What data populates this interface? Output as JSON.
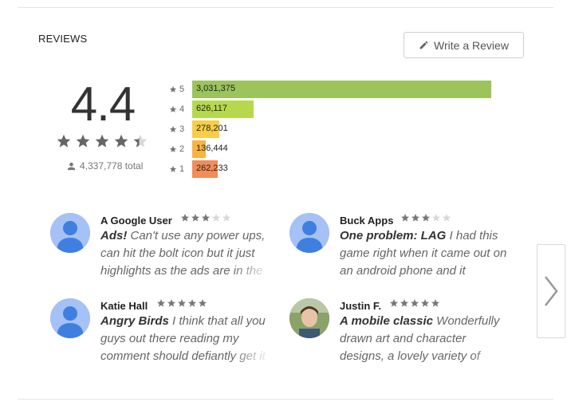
{
  "section": {
    "title": "REVIEWS",
    "write_review_label": "Write a Review"
  },
  "summary": {
    "score": "4.4",
    "stars_fraction": 0.88,
    "total": "4,337,778 total"
  },
  "histogram": [
    {
      "star": "5",
      "count": "3,031,375",
      "fraction": 1.0,
      "color": "#9dc35b"
    },
    {
      "star": "4",
      "count": "626,117",
      "fraction": 0.2065,
      "color": "#b6d84d"
    },
    {
      "star": "3",
      "count": "278,201",
      "fraction": 0.0918,
      "color": "#f7ce46"
    },
    {
      "star": "2",
      "count": "136,444",
      "fraction": 0.045,
      "color": "#f9b342"
    },
    {
      "star": "1",
      "count": "262,233",
      "fraction": 0.0865,
      "color": "#f28c58"
    }
  ],
  "reviews": [
    {
      "name": "A Google User",
      "rating": 3,
      "title": "Ads!",
      "body": " Can't use any power ups, can hit the bolt icon but it just highlights as the ads are in the",
      "avatar": "default-avatar"
    },
    {
      "name": "Buck Apps",
      "rating": 3,
      "title": "One problem: LAG",
      "body": " I had this game right when it came out on an android phone and it",
      "avatar": "default-avatar"
    },
    {
      "name": "Katie Hall",
      "rating": 5,
      "title": "Angry Birds",
      "body": " I think that all you guys out there reading my comment should defiantly get it",
      "avatar": "default-avatar"
    },
    {
      "name": "Justin F.",
      "rating": 5,
      "title": "A mobile classic",
      "body": " Wonderfully drawn art and character designs, a lovely variety of levels",
      "avatar": "photo-avatar"
    }
  ],
  "colors": {
    "star_filled": "#666666",
    "star_empty": "#d8d8d8",
    "avatar_bg": "#a6c1f5",
    "avatar_fg": "#3f7fe0"
  }
}
